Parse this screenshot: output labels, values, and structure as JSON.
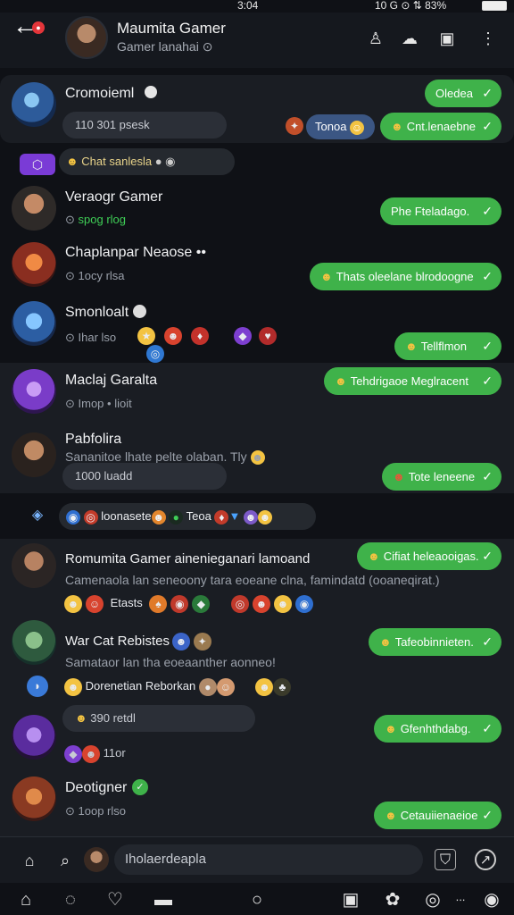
{
  "status_bar": {
    "left": "",
    "time": "3:04",
    "right": "10 G ⊙ ⇅ 83%"
  },
  "header": {
    "title": "Maumita Gamer",
    "subtitle": "Gamer lanahai ⊙"
  },
  "badge": "●",
  "rows": [
    {
      "name": "Cromoieml",
      "sub": "110 301 psesk",
      "btn1": "Oledea",
      "btn2": "Cnt.lenaebne",
      "chip": "Tonoa"
    },
    {
      "label": "Chat sanlesla"
    },
    {
      "name": "Veraogr Gamer",
      "sub": "spog rlog",
      "btn": "Phe Fteladago."
    },
    {
      "name": "Chaplanpar Neaose ••",
      "sub": "1ocy rlsa",
      "btn": "Thats oleelane blrodoogne"
    },
    {
      "name": "Smonloalt",
      "sub": "Ihar lso",
      "btn": "Tellflmon"
    },
    {
      "name": "Maclaj Garalta",
      "sub": "Imop • lioit",
      "btn": "Tehdrigaoe Meglracent"
    },
    {
      "name": "Pabfolira",
      "sub": "Sananitoe lhate pelte olaban. Tly",
      "sub2": "1000 luadd",
      "btn": "Tote leneene"
    },
    {
      "label": "loonasete",
      "label2": "Teoa"
    },
    {
      "name": "Romumita Gamer ainenieganari lamoand",
      "sub": "Camenaola lan seneoony tara eoeane clna, famindatd (ooaneqirat.)",
      "sub2": "Etasts",
      "btn": "Cifiat heleaooigas."
    },
    {
      "name": "War Cat Rebistes",
      "sub": "Samataor lan tha eoeaanther aonneo!",
      "sub2": "Dorenetian Reborkan",
      "btn": "Tafeobinnieten."
    },
    {
      "sub": "390 retdl",
      "sub2": "11or",
      "btn": "Gfenhthdabg."
    },
    {
      "name": "Deotigner",
      "sub": "1oop rlso",
      "btn": "Cetauiienaeioe"
    }
  ],
  "input_placeholder": "Iholaerdeapla",
  "icons": [
    "back-icon",
    "person-icon",
    "puzzle-icon",
    "crop-icon",
    "more-icon",
    "home-icon",
    "search-icon",
    "shield-icon",
    "compass-icon"
  ]
}
